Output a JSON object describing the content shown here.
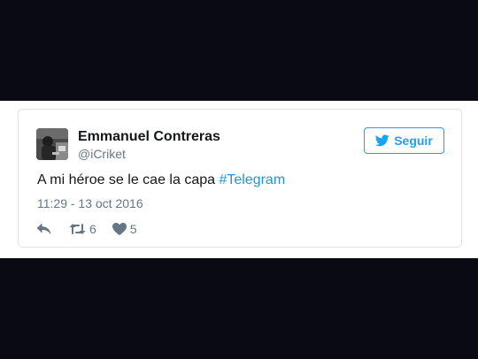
{
  "tweet": {
    "display_name": "Emmanuel Contreras",
    "handle": "@iCriket",
    "follow_label": "Seguir",
    "text_prefix": "A mi héroe se le cae la capa ",
    "hashtag": "#Telegram",
    "timestamp": "11:29 - 13 oct 2016",
    "retweet_count": "6",
    "like_count": "5"
  },
  "colors": {
    "accent": "#1da1f2",
    "hashtag": "#1b95e0",
    "text": "#14171a",
    "muted": "#657786",
    "border": "#dfe3e8",
    "background": "#0a0a14"
  },
  "icons": {
    "follow": "twitter-bird-icon",
    "reply": "reply-icon",
    "retweet": "retweet-icon",
    "like": "heart-icon"
  }
}
